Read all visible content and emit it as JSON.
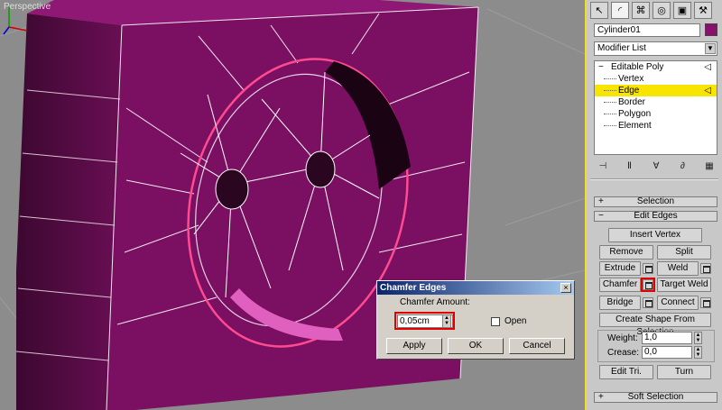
{
  "viewport": {
    "label": "Perspective",
    "colors": {
      "face_front": "#7b0f62",
      "face_side": "#4a0a3a",
      "wire": "#ffffff",
      "selected_edge": "#e0205a",
      "background": "#8c8c8c"
    }
  },
  "panel": {
    "tabs": [
      {
        "icon": "cursor-icon",
        "glyph": "↖"
      },
      {
        "icon": "modify-icon",
        "glyph": "◜"
      },
      {
        "icon": "hierarchy-icon",
        "glyph": "⌘"
      },
      {
        "icon": "motion-icon",
        "glyph": "◎"
      },
      {
        "icon": "display-icon",
        "glyph": "▣"
      },
      {
        "icon": "utilities-icon",
        "glyph": "⚒"
      }
    ],
    "object_name": "Cylinder01",
    "object_color": "#8a0f6e",
    "modifier_list": "Modifier List",
    "stack": {
      "root": "Editable Poly",
      "items": [
        "Vertex",
        "Edge",
        "Border",
        "Polygon",
        "Element"
      ],
      "selected": "Edge"
    },
    "stack_tools": [
      {
        "icon": "pin-stack-icon",
        "glyph": "⊣"
      },
      {
        "icon": "show-end-result-icon",
        "glyph": "Ⅱ"
      },
      {
        "icon": "make-unique-icon",
        "glyph": "∀"
      },
      {
        "icon": "remove-modifier-icon",
        "glyph": "∂"
      },
      {
        "icon": "configure-sets-icon",
        "glyph": "▦"
      }
    ],
    "rollouts": {
      "selection": {
        "sign": "+",
        "title": "Selection"
      },
      "edit_edges": {
        "sign": "−",
        "title": "Edit Edges"
      },
      "soft_selection": {
        "sign": "+",
        "title": "Soft Selection"
      }
    },
    "buttons": {
      "insert_vertex": "Insert Vertex",
      "remove": "Remove",
      "split": "Split",
      "extrude": "Extrude",
      "weld": "Weld",
      "chamfer": "Chamfer",
      "target_weld": "Target Weld",
      "bridge": "Bridge",
      "connect": "Connect",
      "create_shape": "Create Shape From Selection",
      "edit_tri": "Edit Tri.",
      "turn": "Turn"
    },
    "weight": {
      "label": "Weight:",
      "value": "1,0"
    },
    "crease": {
      "label": "Crease:",
      "value": "0,0"
    }
  },
  "dialog": {
    "title": "Chamfer Edges",
    "close": "×",
    "amount_label": "Chamfer Amount:",
    "amount_value": "0,05cm",
    "open_label": "Open",
    "open_checked": false,
    "apply": "Apply",
    "ok": "OK",
    "cancel": "Cancel"
  }
}
